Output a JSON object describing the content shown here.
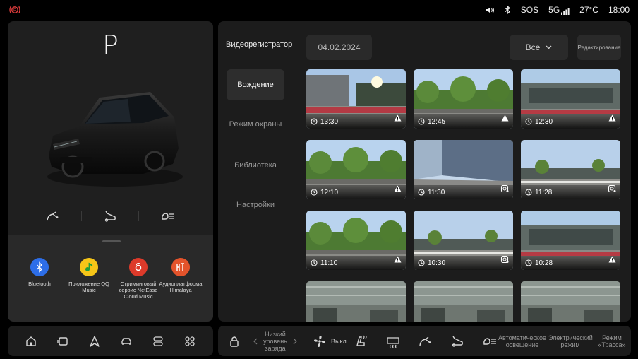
{
  "status": {
    "sos": "SOS",
    "network": "5G",
    "temperature": "27°C",
    "clock": "18:00"
  },
  "vehicle": {
    "gear": "P"
  },
  "apps": [
    {
      "label": "Bluetooth",
      "color": "#2d6ee8",
      "icon": "bluetooth-icon"
    },
    {
      "label": "Приложение QQ Music",
      "color": "#f5c518",
      "icon": "qq-music-icon"
    },
    {
      "label": "Стриминговый сервис NetEase Cloud Music",
      "color": "#dd3a2a",
      "icon": "netease-music-icon"
    },
    {
      "label": "Аудиоплатформа Himalaya",
      "color": "#e3532b",
      "icon": "himalaya-icon"
    }
  ],
  "recorder": {
    "title": "Видеорегистратор",
    "date": "04.02.2024",
    "filter": "Все",
    "edit": "Редактирование",
    "nav": [
      {
        "label": "Вождение",
        "active": true
      },
      {
        "label": "Режим охраны",
        "active": false
      },
      {
        "label": "Библиотека",
        "active": false
      },
      {
        "label": "Настройки",
        "active": false
      }
    ],
    "clips": [
      {
        "time": "13:30",
        "badge": "warning-icon",
        "scene": "street"
      },
      {
        "time": "12:45",
        "badge": "warning-icon",
        "scene": "trees"
      },
      {
        "time": "12:30",
        "badge": "warning-icon",
        "scene": "building"
      },
      {
        "time": "12:10",
        "badge": "warning-icon",
        "scene": "trees"
      },
      {
        "time": "11:30",
        "badge": "capture-icon",
        "scene": "glass"
      },
      {
        "time": "11:28",
        "badge": "capture-icon",
        "scene": "lot"
      },
      {
        "time": "11:10",
        "badge": "warning-icon",
        "scene": "trees"
      },
      {
        "time": "10:30",
        "badge": "capture-icon",
        "scene": "lot"
      },
      {
        "time": "10:28",
        "badge": "warning-icon",
        "scene": "building"
      },
      {
        "time": "",
        "badge": "",
        "scene": "garage"
      },
      {
        "time": "",
        "badge": "",
        "scene": "garage"
      },
      {
        "time": "",
        "badge": "",
        "scene": "garage"
      }
    ]
  },
  "dock": {
    "charge_low": "Низкий уровень заряда",
    "fan": "Выкл.",
    "auto_light": "Автоматическое освещение",
    "electric": "Электрический режим",
    "highway": "Режим «Трасса»"
  },
  "colors": {
    "background": "#000000",
    "panel": "#1c1c1c",
    "alert_red": "#e43d3d",
    "text": "#e8e8e8"
  }
}
